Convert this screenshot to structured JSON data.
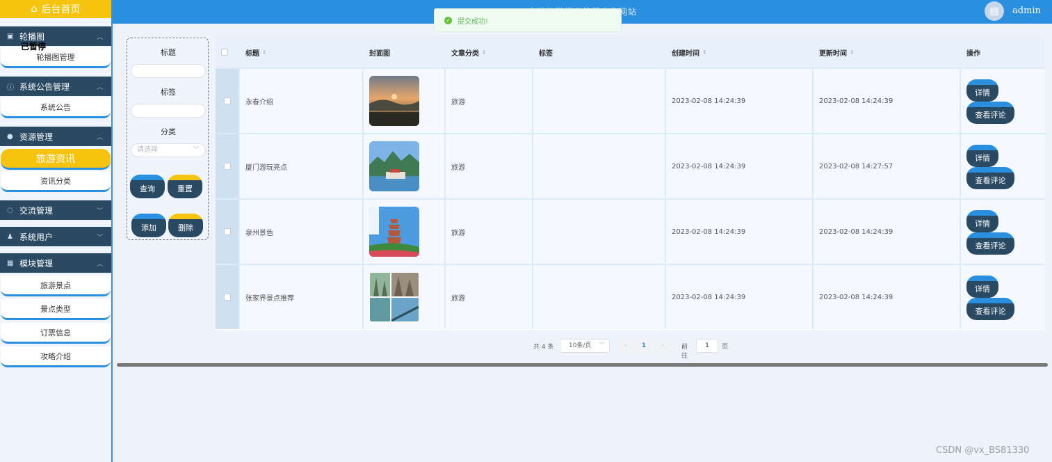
{
  "header": {
    "site_title": "台湾旅游招商推荐文化网站",
    "username": "admin"
  },
  "toast": {
    "message": "提交成功!"
  },
  "sidebar": {
    "home": "后台首页",
    "paused": "已暂停",
    "groups": [
      {
        "label": "轮播图",
        "icon": "image-icon"
      },
      {
        "label": "系统公告管理",
        "icon": "info-icon"
      },
      {
        "label": "资源管理",
        "icon": "location-icon"
      },
      {
        "label": "交流管理",
        "icon": "chat-icon"
      },
      {
        "label": "系统用户",
        "icon": "user-icon"
      },
      {
        "label": "模块管理",
        "icon": "grid-icon"
      }
    ],
    "items": {
      "carousel_manage": "轮播图管理",
      "system_notice": "系统公告",
      "travel_news": "旅游资讯",
      "news_category": "资讯分类",
      "scenic_spots": "旅游景点",
      "spot_types": "景点类型",
      "tickets": "订票信息",
      "guides": "攻略介绍"
    }
  },
  "search": {
    "title_label": "标题",
    "tag_label": "标签",
    "category_label": "分类",
    "category_placeholder": "请选择",
    "query_btn": "查询",
    "reset_btn": "重置",
    "add_btn": "添加",
    "delete_btn": "删除"
  },
  "table": {
    "columns": {
      "title": "标题",
      "cover": "封面图",
      "category": "文章分类",
      "tags": "标签",
      "created": "创建时间",
      "updated": "更新时间",
      "actions": "操作"
    },
    "detail_btn": "详情",
    "comments_btn": "查看评论",
    "rows": [
      {
        "title": "永春介绍",
        "category": "旅游",
        "tags": "",
        "created": "2023-02-08 14:24:39",
        "updated": "2023-02-08 14:24:39"
      },
      {
        "title": "厦门游玩亮点",
        "category": "旅游",
        "tags": "",
        "created": "2023-02-08 14:24:39",
        "updated": "2023-02-08 14:27:57"
      },
      {
        "title": "泉州景色",
        "category": "旅游",
        "tags": "",
        "created": "2023-02-08 14:24:39",
        "updated": "2023-02-08 14:24:39"
      },
      {
        "title": "张家界景点推荐",
        "category": "旅游",
        "tags": "",
        "created": "2023-02-08 14:24:39",
        "updated": "2023-02-08 14:24:39"
      }
    ]
  },
  "pagination": {
    "total": "共 4 条",
    "page_size": "10条/页",
    "prev": "‹",
    "current": "1",
    "next": "›",
    "goto": "前往",
    "goto_value": "1",
    "unit": "页"
  },
  "watermark": "CSDN @vx_BS81330",
  "colors": {
    "primary": "#2a8fdf",
    "accent": "#f6c40f",
    "dark": "#2a4a63"
  }
}
